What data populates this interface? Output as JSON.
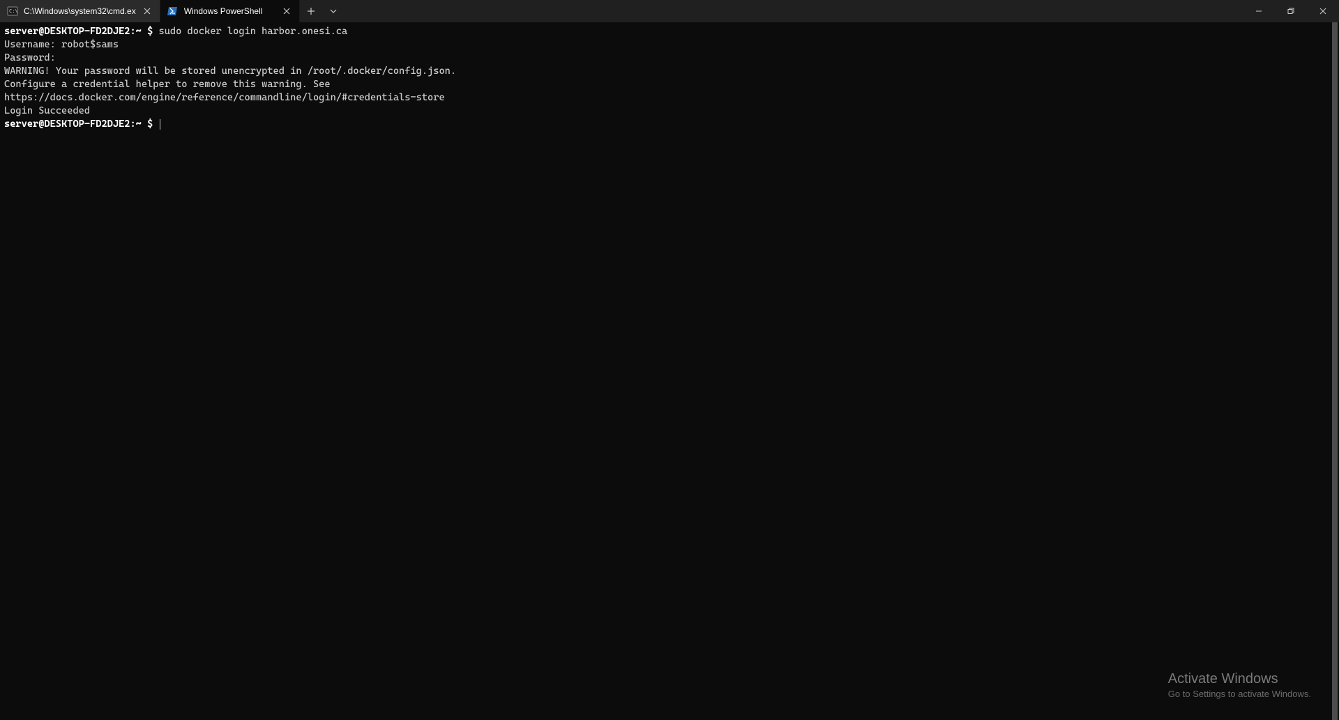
{
  "tabs": [
    {
      "label": "C:\\Windows\\system32\\cmd.ex",
      "icon": "cmd-icon",
      "active": false
    },
    {
      "label": "Windows PowerShell",
      "icon": "powershell-icon",
      "active": true
    }
  ],
  "terminal": {
    "prompt1_user": "server@DESKTOP-FD2DJE2:",
    "prompt1_path": "~",
    "prompt1_symbol": " $ ",
    "cmd1": "sudo docker login harbor.onesi.ca",
    "line_username": "Username: robot$sams",
    "line_password": "Password:",
    "line_warn1": "WARNING! Your password will be stored unencrypted in /root/.docker/config.json.",
    "line_warn2": "Configure a credential helper to remove this warning. See",
    "line_warn3": "https://docs.docker.com/engine/reference/commandline/login/#credentials-store",
    "line_blank": "",
    "line_success": "Login Succeeded",
    "prompt2_user": "server@DESKTOP-FD2DJE2:",
    "prompt2_path": "~",
    "prompt2_symbol": " $ "
  },
  "watermark": {
    "title": "Activate Windows",
    "sub": "Go to Settings to activate Windows."
  }
}
